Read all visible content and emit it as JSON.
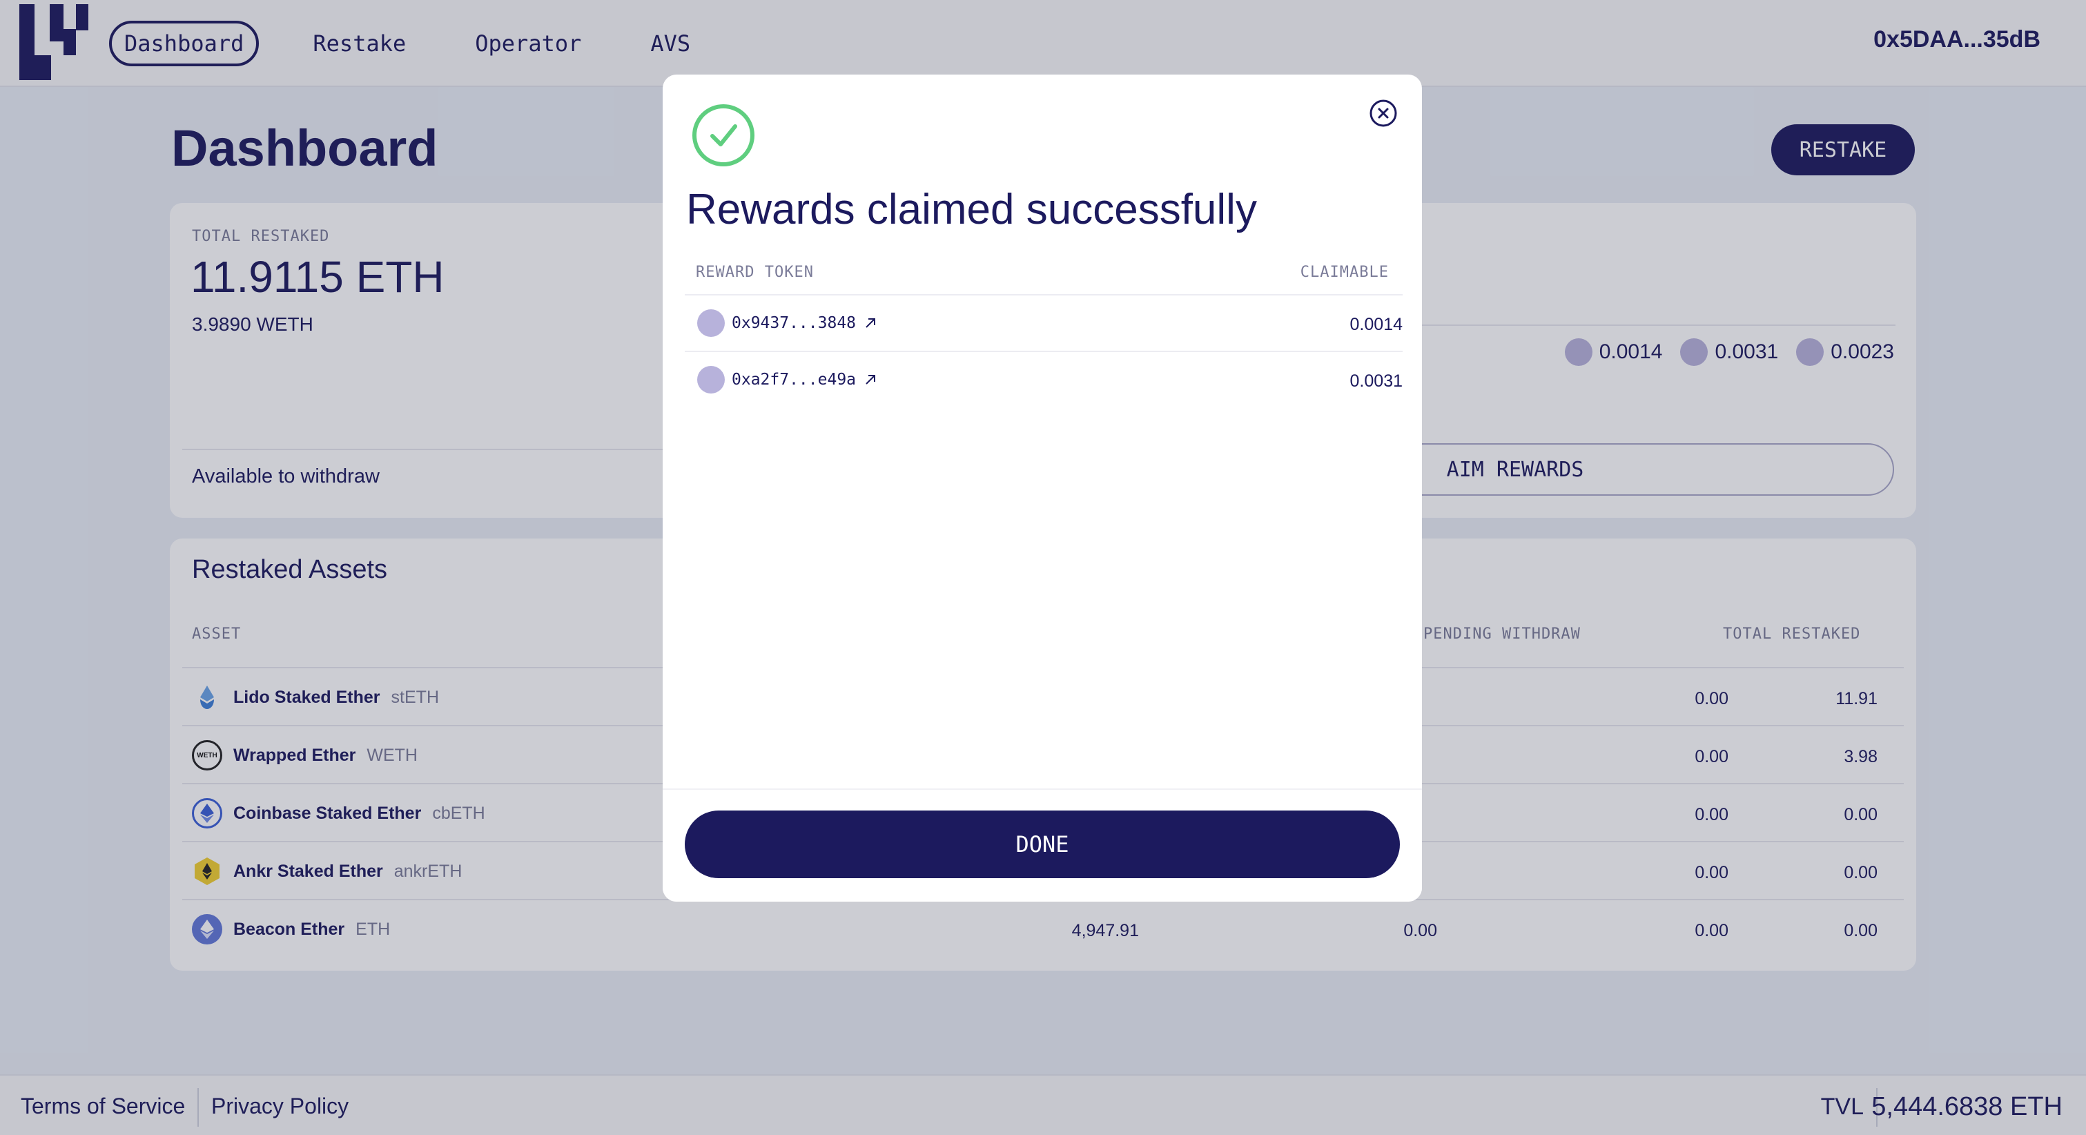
{
  "header": {
    "nav": [
      "Dashboard",
      "Restake",
      "Operator",
      "AVS"
    ],
    "active_nav": "Dashboard",
    "wallet": "0x5DAA...35dB"
  },
  "page": {
    "title": "Dashboard",
    "restake_button": "RESTAKE"
  },
  "summary": {
    "total_label": "TOTAL RESTAKED",
    "total_eth": "11.9115 ETH",
    "total_weth": "3.9890 WETH",
    "available_label": "Available to withdraw",
    "reward_chips": [
      "0.0014",
      "0.0031",
      "0.0023"
    ],
    "claim_button": "AIM REWARDS"
  },
  "assets": {
    "title": "Restaked Assets",
    "headers": {
      "asset": "ASSET",
      "pending": "PENDING WITHDRAW",
      "total": "TOTAL RESTAKED"
    },
    "rows": [
      {
        "name": "Lido Staked Ether",
        "symbol": "stETH",
        "col_a": "",
        "col_b": "",
        "pending": "0.00",
        "total": "11.91"
      },
      {
        "name": "Wrapped Ether",
        "symbol": "WETH",
        "col_a": "",
        "col_b": "",
        "pending": "0.00",
        "total": "3.98"
      },
      {
        "name": "Coinbase Staked Ether",
        "symbol": "cbETH",
        "col_a": "",
        "col_b": "",
        "pending": "0.00",
        "total": "0.00"
      },
      {
        "name": "Ankr Staked Ether",
        "symbol": "ankrETH",
        "col_a": "",
        "col_b": "",
        "pending": "0.00",
        "total": "0.00"
      },
      {
        "name": "Beacon Ether",
        "symbol": "ETH",
        "col_a": "4,947.91",
        "col_b": "0.00",
        "pending": "0.00",
        "total": "0.00"
      }
    ]
  },
  "footer": {
    "terms": "Terms of Service",
    "privacy": "Privacy Policy",
    "tvl_label": "TVL",
    "tvl_value": "5,444.6838 ETH"
  },
  "modal": {
    "title": "Rewards claimed successfully",
    "col_token": "REWARD TOKEN",
    "col_claimable": "CLAIMABLE",
    "rows": [
      {
        "token": "0x9437...3848",
        "value": "0.0014"
      },
      {
        "token": "0xa2f7...e49a",
        "value": "0.0031"
      }
    ],
    "done_button": "DONE"
  },
  "colors": {
    "primary": "#1c1a5e",
    "success": "#5fce7f",
    "token_dot": "#b7b2db"
  }
}
